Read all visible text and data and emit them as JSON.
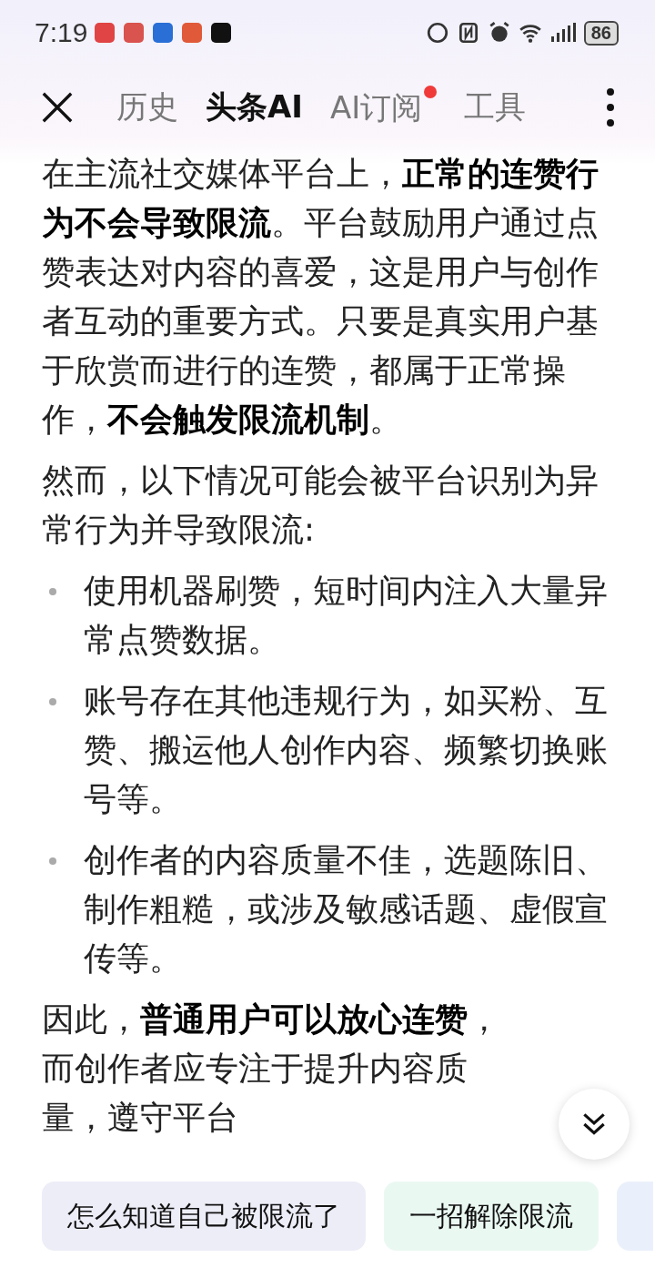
{
  "status_bar": {
    "time": "7:19",
    "battery": "86"
  },
  "tabs": [
    {
      "label": "历史",
      "selected": false,
      "dot": false
    },
    {
      "label": "头条AI",
      "selected": true,
      "dot": false
    },
    {
      "label": "AI订阅",
      "selected": false,
      "dot": true
    },
    {
      "label": "工具",
      "selected": false,
      "dot": false
    }
  ],
  "content": [
    {
      "kind": "paragraph",
      "text": "在主流社交媒体平台上，**正常的连赞行为不会导致限流**。平台鼓励用户通过点赞表达对内容的喜爱，这是用户与创作者互动的重要方式。只要是真实用户基于欣赏而进行的连赞，都属于正常操作，**不会触发限流机制**。"
    },
    {
      "kind": "paragraph",
      "text": "然而，以下情况可能会被平台识别为异常行为并导致限流:"
    },
    {
      "kind": "bullet",
      "text": "使用机器刷赞，短时间内注入大量异常点赞数据。"
    },
    {
      "kind": "bullet",
      "text": "账号存在其他违规行为，如买粉、互赞、搬运他人创作内容、频繁切换账号等。"
    },
    {
      "kind": "bullet",
      "text": "创作者的内容质量不佳，选题陈旧、制作粗糙，或涉及敏感话题、虚假宣传等。"
    },
    {
      "kind": "paragraph",
      "text": "因此，**普通用户可以放心连赞**，而创作者应专注于提升内容质量，遵守平台"
    }
  ],
  "suggestions": [
    {
      "text": "怎么知道自己被限流了",
      "color": "#ededf8"
    },
    {
      "text": "一招解除限流",
      "color": "#eaf8f2"
    }
  ]
}
